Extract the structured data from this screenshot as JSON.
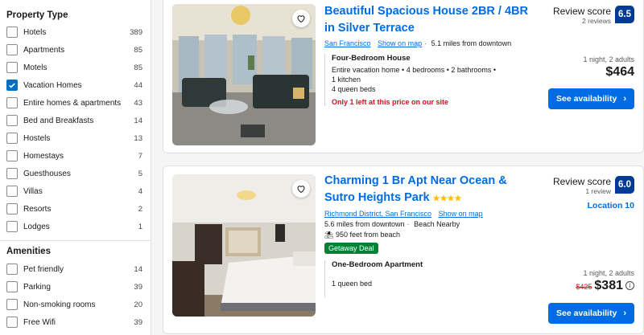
{
  "sidebar": {
    "property_type_title": "Property Type",
    "property_types": [
      {
        "label": "Hotels",
        "count": "389",
        "checked": false
      },
      {
        "label": "Apartments",
        "count": "85",
        "checked": false
      },
      {
        "label": "Motels",
        "count": "85",
        "checked": false
      },
      {
        "label": "Vacation Homes",
        "count": "44",
        "checked": true
      },
      {
        "label": "Entire homes & apartments",
        "count": "43",
        "checked": false
      },
      {
        "label": "Bed and Breakfasts",
        "count": "14",
        "checked": false
      },
      {
        "label": "Hostels",
        "count": "13",
        "checked": false
      },
      {
        "label": "Homestays",
        "count": "7",
        "checked": false
      },
      {
        "label": "Guesthouses",
        "count": "5",
        "checked": false
      },
      {
        "label": "Villas",
        "count": "4",
        "checked": false
      },
      {
        "label": "Resorts",
        "count": "2",
        "checked": false
      },
      {
        "label": "Lodges",
        "count": "1",
        "checked": false
      }
    ],
    "amenities_title": "Amenities",
    "amenities": [
      {
        "label": "Pet friendly",
        "count": "14",
        "checked": false
      },
      {
        "label": "Parking",
        "count": "39",
        "checked": false
      },
      {
        "label": "Non-smoking rooms",
        "count": "20",
        "checked": false
      },
      {
        "label": "Free Wifi",
        "count": "39",
        "checked": false
      }
    ]
  },
  "listings": [
    {
      "title": "Beautiful Spacious House 2BR / 4BR in Silver Terrace",
      "location": "San Francisco",
      "map_link": "Show on map",
      "distance": "5.1 miles from downtown",
      "room_name": "Four-Bedroom House",
      "room_details": [
        "Entire vacation home • 4 bedrooms • 2 bathrooms •",
        "1 kitchen",
        "4 queen beds"
      ],
      "urgency": "Only 1 left at this price on our site",
      "review_title": "Review score",
      "review_count": "2 reviews",
      "score": "6.5",
      "stay": "1 night, 2 adults",
      "price": "$464",
      "button": "See availability"
    },
    {
      "title": "Charming 1 Br Apt Near Ocean & Sutro Heights Park",
      "stars": "★★★★",
      "location": "Richmond District, San Francisco",
      "map_link": "Show on map",
      "distance": "5.6 miles from downtown",
      "extra": "Beach Nearby",
      "beach": "950 feet from beach",
      "deal": "Getaway Deal",
      "room_name": "One-Bedroom Apartment",
      "room_details": [
        "1 queen bed"
      ],
      "review_title": "Review score",
      "review_count": "1 review",
      "score": "6.0",
      "location_score": "Location 10",
      "stay": "1 night, 2 adults",
      "old_price": "$425",
      "price": "$381",
      "button": "See availability"
    }
  ],
  "colors": {
    "brand_blue": "#006ce4",
    "score_blue": "#003b95",
    "urgent_red": "#d4111e",
    "deal_green": "#008234"
  }
}
